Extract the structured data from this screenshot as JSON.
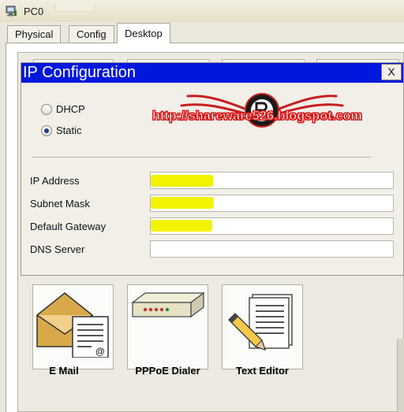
{
  "window": {
    "title": "PC0",
    "icon": "pc-icon"
  },
  "tabs": [
    {
      "label": "Physical",
      "active": false
    },
    {
      "label": "Config",
      "active": false
    },
    {
      "label": "Desktop",
      "active": true
    }
  ],
  "dialog": {
    "title": "IP Configuration",
    "close_label": "X",
    "watermark": "http://shareware526.blogspot.com",
    "mode": {
      "options": [
        {
          "label": "DHCP",
          "selected": false
        },
        {
          "label": "Static",
          "selected": true
        }
      ]
    },
    "fields": [
      {
        "label": "IP Address",
        "value": "",
        "highlighted": true
      },
      {
        "label": "Subnet Mask",
        "value": "",
        "highlighted": true
      },
      {
        "label": "Default Gateway",
        "value": "",
        "highlighted": true
      },
      {
        "label": "DNS Server",
        "value": "",
        "highlighted": false
      }
    ],
    "highlight_color": "#f3f300"
  },
  "apps": [
    {
      "label": "E Mail",
      "icon": "email-icon"
    },
    {
      "label": "PPPoE Dialer",
      "icon": "pppoe-dialer-icon"
    },
    {
      "label": "Text Editor",
      "icon": "text-editor-icon"
    }
  ],
  "colors": {
    "dialog_title_bar": "#0018dd",
    "watermark": "#d41a1a"
  }
}
